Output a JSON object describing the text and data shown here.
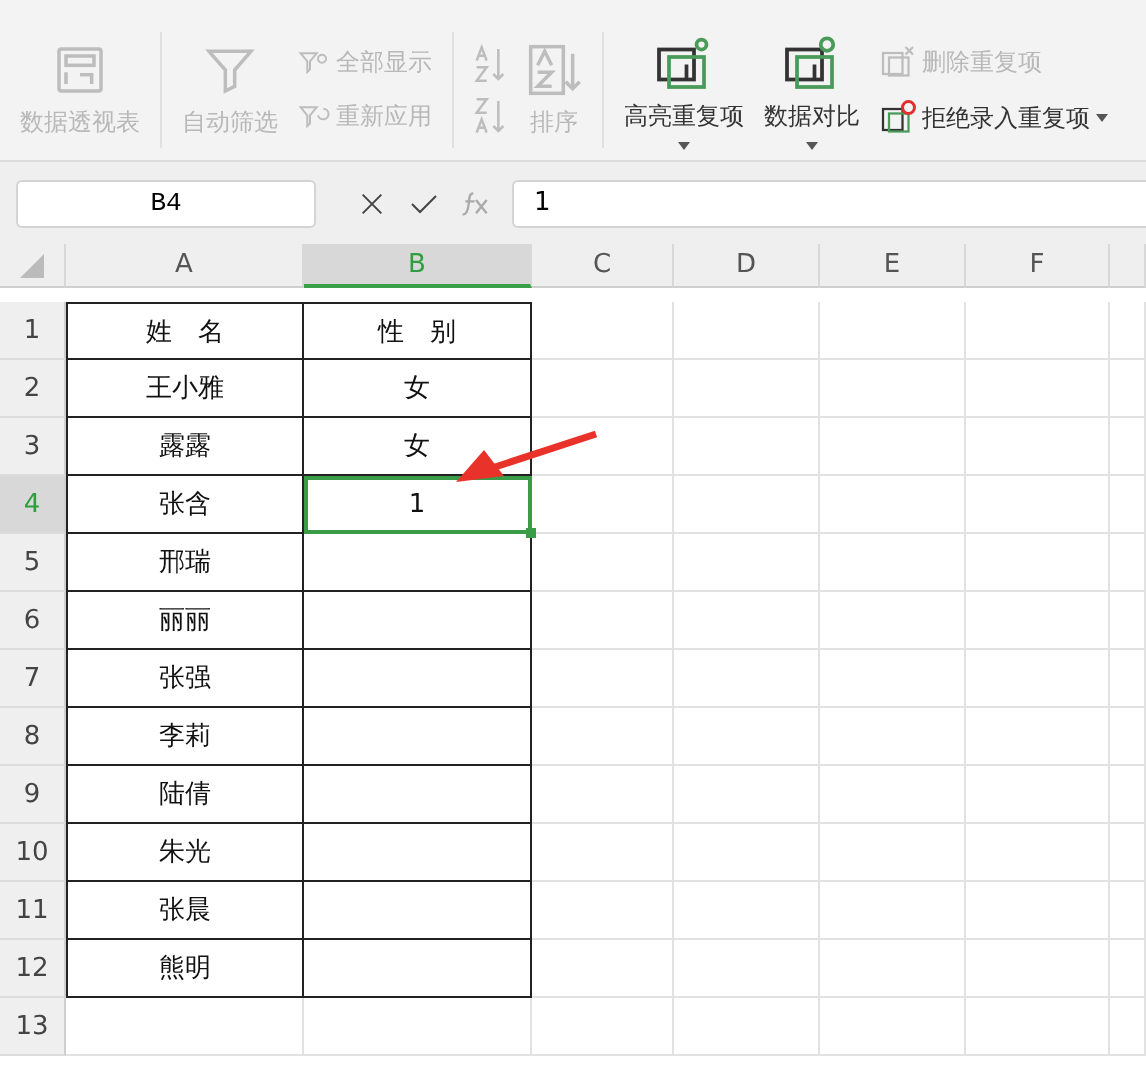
{
  "ribbon": {
    "pivot": {
      "label": "数据透视表",
      "disabled": true
    },
    "filter": {
      "label": "自动筛选",
      "disabled": true
    },
    "show_all": {
      "label": "全部显示",
      "disabled": true
    },
    "reapply": {
      "label": "重新应用",
      "disabled": true
    },
    "sort": {
      "label": "排序",
      "disabled": true
    },
    "highlight_dup": {
      "label": "高亮重复项",
      "disabled": false
    },
    "compare": {
      "label": "数据对比",
      "disabled": false
    },
    "remove_dup": {
      "label": "删除重复项",
      "disabled": true
    },
    "reject_dup": {
      "label": "拒绝录入重复项",
      "disabled": false
    }
  },
  "formula_bar": {
    "name_box": "B4",
    "formula": "1"
  },
  "columns": [
    {
      "label": "A",
      "selected": false
    },
    {
      "label": "B",
      "selected": true
    },
    {
      "label": "C",
      "selected": false
    },
    {
      "label": "D",
      "selected": false
    },
    {
      "label": "E",
      "selected": false
    },
    {
      "label": "F",
      "selected": false
    }
  ],
  "rows": [
    {
      "number": "1",
      "selected": false,
      "cells": [
        {
          "text": "姓　名",
          "selected": false
        },
        {
          "text": "性　别",
          "selected": false
        }
      ]
    },
    {
      "number": "2",
      "selected": false,
      "cells": [
        {
          "text": "王小雅",
          "selected": false
        },
        {
          "text": "女",
          "selected": false
        }
      ]
    },
    {
      "number": "3",
      "selected": false,
      "cells": [
        {
          "text": "露露",
          "selected": false
        },
        {
          "text": "女",
          "selected": false
        }
      ]
    },
    {
      "number": "4",
      "selected": true,
      "cells": [
        {
          "text": "张含",
          "selected": false
        },
        {
          "text": "1",
          "selected": true
        }
      ]
    },
    {
      "number": "5",
      "selected": false,
      "cells": [
        {
          "text": "邢瑞",
          "selected": false
        }
      ]
    },
    {
      "number": "6",
      "selected": false,
      "cells": [
        {
          "text": "丽丽",
          "selected": false
        }
      ]
    },
    {
      "number": "7",
      "selected": false,
      "cells": [
        {
          "text": "张强",
          "selected": false
        }
      ]
    },
    {
      "number": "8",
      "selected": false,
      "cells": [
        {
          "text": "李莉",
          "selected": false
        }
      ]
    },
    {
      "number": "9",
      "selected": false,
      "cells": [
        {
          "text": "陆倩",
          "selected": false
        }
      ]
    },
    {
      "number": "10",
      "selected": false,
      "cells": [
        {
          "text": "朱光",
          "selected": false
        }
      ]
    },
    {
      "number": "11",
      "selected": false,
      "cells": [
        {
          "text": "张晨",
          "selected": false
        }
      ]
    },
    {
      "number": "12",
      "selected": false,
      "cells": [
        {
          "text": "熊明",
          "selected": false
        }
      ]
    },
    {
      "number": "13",
      "selected": false,
      "cells": []
    }
  ]
}
